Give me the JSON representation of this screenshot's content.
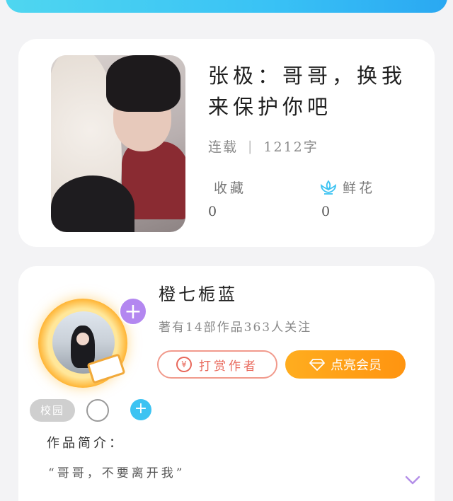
{
  "book": {
    "title": "张极：哥哥，换我来保护你吧",
    "status": "连载",
    "separator": "|",
    "word_count": "1212字",
    "favorites_label": "收藏",
    "favorites_count": "0",
    "flowers_label": "鲜花",
    "flowers_count": "0"
  },
  "author": {
    "name": "橙七栀蓝",
    "stats": "著有14部作品363人关注",
    "reward_button": "打赏作者",
    "reward_icon": "¥",
    "vip_button": "点亮会员",
    "follow_icon": "+",
    "tag_campus": "校园",
    "tag_add": "+"
  },
  "intro": {
    "title": "作品简介：",
    "text": "“哥哥，不要离开我”"
  },
  "colors": {
    "accent_blue": "#39c2f5",
    "vip_orange": "#ff9f18",
    "reward_red": "#e8675a",
    "follow_purple": "#b387f0"
  }
}
